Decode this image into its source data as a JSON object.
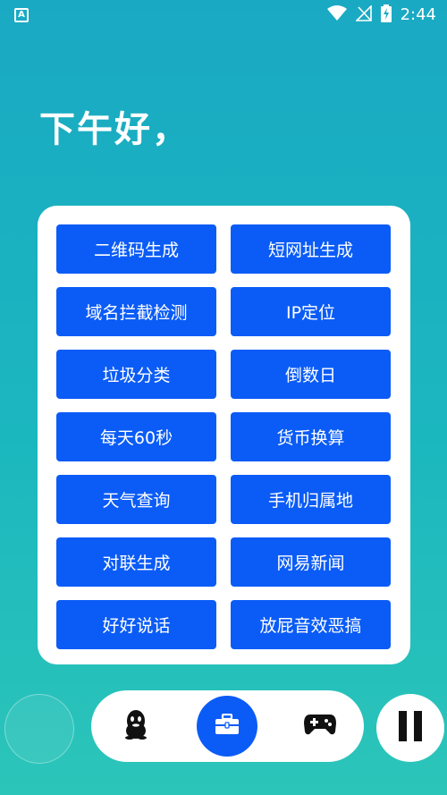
{
  "status_bar": {
    "app_icon": "A",
    "icons": [
      "wifi-icon",
      "signal-off-icon",
      "battery-charging-icon"
    ],
    "time": "2:44"
  },
  "greeting": "下午好，",
  "tools": [
    {
      "label": "二维码生成"
    },
    {
      "label": "短网址生成"
    },
    {
      "label": "域名拦截检测"
    },
    {
      "label": "IP定位"
    },
    {
      "label": "垃圾分类"
    },
    {
      "label": "倒数日"
    },
    {
      "label": "每天60秒"
    },
    {
      "label": "货币换算"
    },
    {
      "label": "天气查询"
    },
    {
      "label": "手机归属地"
    },
    {
      "label": "对联生成"
    },
    {
      "label": "网易新闻"
    },
    {
      "label": "好好说话"
    },
    {
      "label": "放屁音效恶搞"
    }
  ],
  "bottom_nav": {
    "items": [
      "qq-icon",
      "toolbox-icon",
      "gamepad-icon"
    ],
    "active": "toolbox-icon"
  },
  "colors": {
    "accent": "#0b5cf6",
    "background_top": "#1aa9c3",
    "background_bottom": "#2cc5b9"
  }
}
